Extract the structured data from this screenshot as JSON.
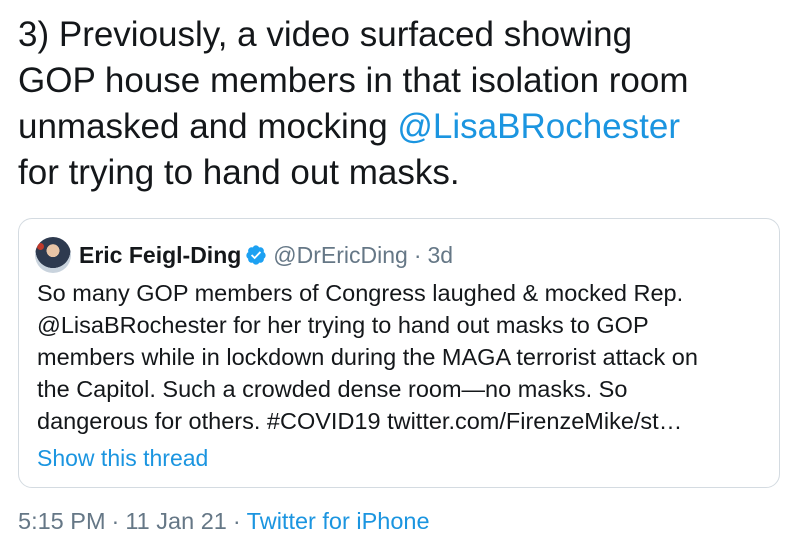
{
  "tweet": {
    "lines": [
      "3) Previously, a video surfaced showing",
      "GOP house members in that isolation room",
      "unmasked and mocking ",
      "for trying to hand out masks."
    ],
    "mention": "@LisaBRochester"
  },
  "quote": {
    "display_name": "Eric Feigl-Ding",
    "handle": "@DrEricDing",
    "separator": "·",
    "time": "3d",
    "body_lines": [
      "So many GOP members of Congress laughed & mocked Rep.",
      "@LisaBRochester for her trying to hand out masks to GOP",
      "members while in lockdown during the MAGA terrorist attack on",
      "the Capitol. Such a crowded dense room—no masks. So",
      "dangerous for others. #COVID19 twitter.com/FirenzeMike/st…"
    ],
    "show_thread": "Show this thread"
  },
  "meta": {
    "time": "5:15 PM",
    "dot1": "·",
    "date": "11 Jan 21",
    "dot2": "·",
    "source": "Twitter for iPhone"
  },
  "colors": {
    "link": "#1b95e0",
    "muted": "#657786",
    "text": "#14171a",
    "border": "#d4dbe1"
  },
  "icons": {
    "verified": "verified-badge-icon"
  }
}
